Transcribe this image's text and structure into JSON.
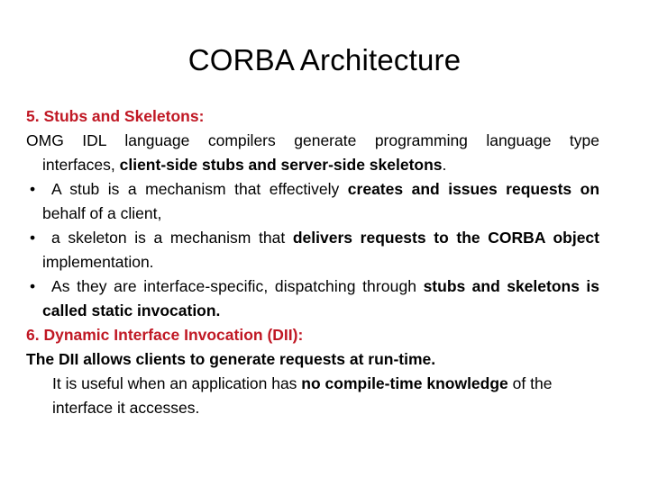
{
  "slide": {
    "title": "CORBA Architecture",
    "colors": {
      "heading_red": "#C01824",
      "body_black": "#000000",
      "background": "#FFFFFF"
    },
    "bullet_glyph": "•",
    "sections": [
      {
        "heading": "5. Stubs and Skeletons:",
        "paragraph": {
          "line1": "OMG IDL language compilers generate programming language type",
          "line2_regular_prefix": "interfaces,",
          "line2_bold": "client-side stubs and server-side skeletons",
          "line2_regular_suffix": "."
        },
        "bullets": [
          {
            "line1_regular": "A stub is a mechanism that effectively",
            "line1_bold": "creates and issues requests on",
            "line2_regular": "behalf of a client,"
          },
          {
            "line1_regular": "a skeleton is a mechanism that",
            "line1_bold": "delivers requests to the CORBA object",
            "line2_regular": "implementation."
          },
          {
            "line1_regular": "As they are interface-specific, dispatching through",
            "line1_bold": "stubs and skeletons is",
            "line2_bold": "called static invocation."
          }
        ]
      },
      {
        "heading": "6. Dynamic Interface Invocation (DII):",
        "lead_bold": "The DII allows clients to generate requests at run-time.",
        "closing": {
          "line1_regular_prefix": "It is useful when an application has",
          "line1_bold": "no compile-time knowledge",
          "line1_regular_suffix": "of the",
          "line2_regular": "interface it accesses."
        }
      }
    ]
  }
}
